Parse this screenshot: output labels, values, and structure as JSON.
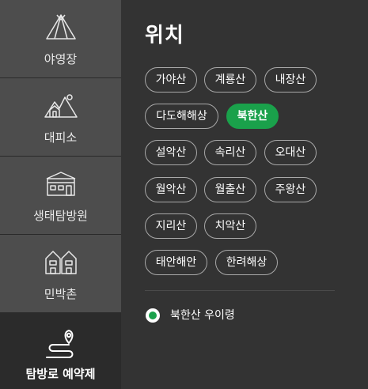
{
  "sidebar": {
    "items": [
      {
        "label": "야영장",
        "icon": "tent-icon"
      },
      {
        "label": "대피소",
        "icon": "shelter-icon"
      },
      {
        "label": "생태탐방원",
        "icon": "eco-center-icon"
      },
      {
        "label": "민박촌",
        "icon": "guesthouse-icon"
      },
      {
        "label": "탐방로 예약제",
        "icon": "trail-map-pin-icon",
        "active": true
      }
    ]
  },
  "main": {
    "title": "위치",
    "locations": [
      "가야산",
      "계룡산",
      "내장산",
      "다도해해상",
      "북한산",
      "설악산",
      "속리산",
      "오대산",
      "월악산",
      "월출산",
      "주왕산",
      "지리산",
      "치악산",
      "태안해안",
      "한려해상"
    ],
    "selected_location": "북한산",
    "trail_option": "북한산 우이령"
  },
  "colors": {
    "accent": "#1aa14b",
    "sidebar_bg": "#4d4d4d",
    "main_bg": "#333333"
  }
}
